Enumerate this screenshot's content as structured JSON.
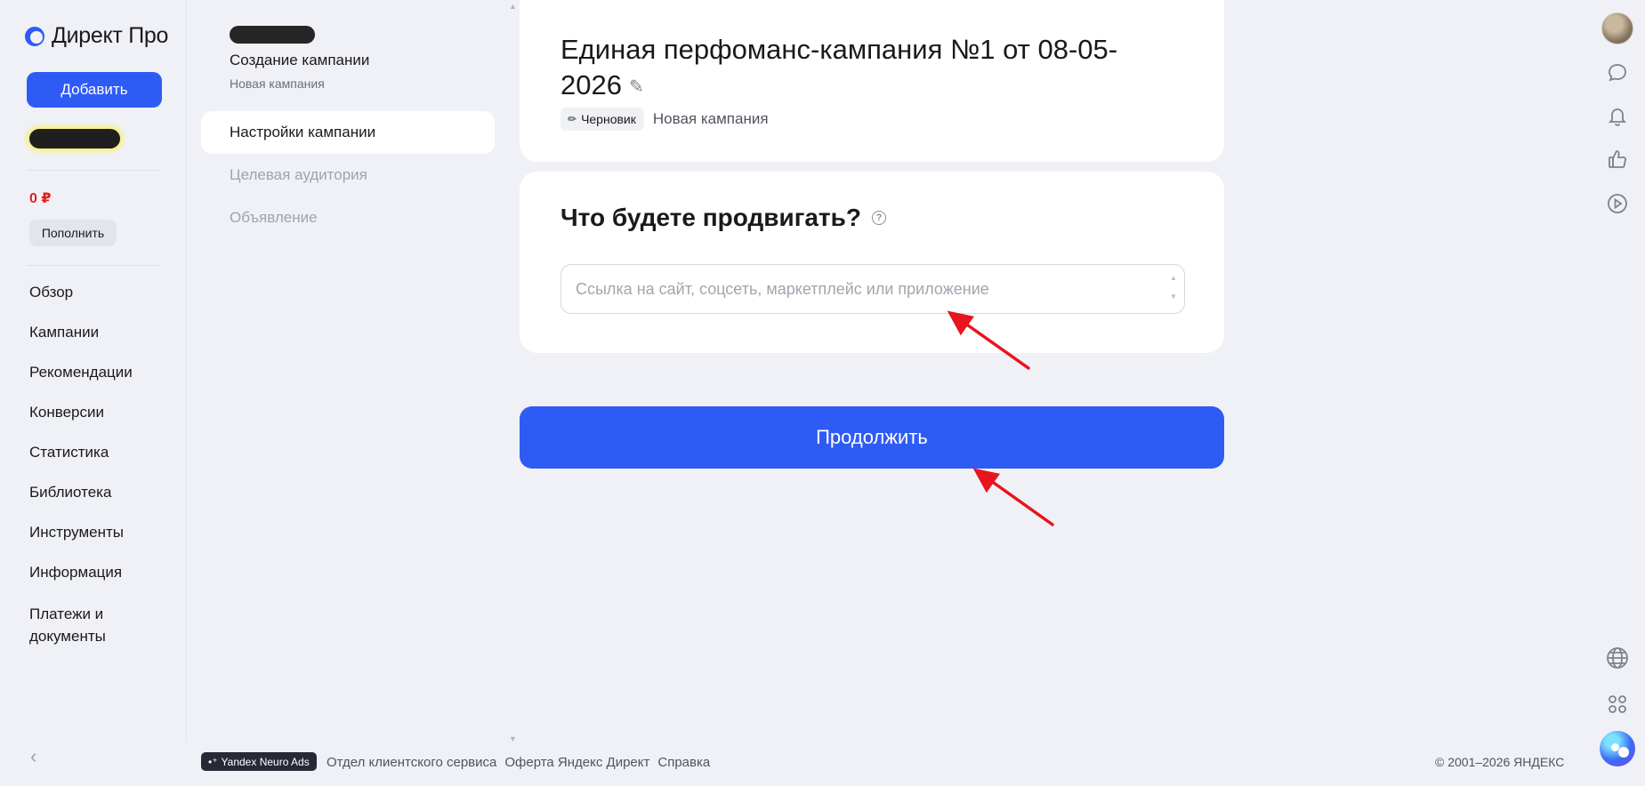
{
  "app": {
    "logo_text": "Директ Про"
  },
  "sidebar": {
    "add_button": "Добавить",
    "balance": "0 ₽",
    "topup_button": "Пополнить",
    "nav": [
      "Обзор",
      "Кампании",
      "Рекомендации",
      "Конверсии",
      "Статистика",
      "Библиотека",
      "Инструменты",
      "Информация",
      "Платежи и документы"
    ],
    "collapse_glyph": "‹"
  },
  "wizard": {
    "title": "Создание кампании",
    "subtitle": "Новая кампания",
    "steps": [
      {
        "label": "Настройки кампании",
        "active": true
      },
      {
        "label": "Целевая аудитория",
        "active": false
      },
      {
        "label": "Объявление",
        "active": false
      }
    ]
  },
  "campaign": {
    "title": "Единая перфоманс-кампания №1 от 08-05-2026",
    "draft_badge": "Черновик",
    "status": "Новая кампания"
  },
  "promo": {
    "question": "Что будете продвигать?",
    "help_glyph": "?",
    "input_placeholder": "Ссылка на сайт, соцсеть, маркетплейс или приложение",
    "input_value": ""
  },
  "actions": {
    "continue_button": "Продолжить"
  },
  "footer": {
    "badge": "Yandex Neuro Ads",
    "links": [
      "Отдел клиентского сервиса",
      "Оферта Яндекс Директ",
      "Справка"
    ],
    "copyright": "© 2001–2026 ЯНДЕКС"
  },
  "colors": {
    "accent": "#2f5bf5",
    "background": "#f0f1f6",
    "card": "#ffffff",
    "balance": "#e61e1e",
    "annotation_arrow": "#e8141e"
  },
  "icons": {
    "right_rail": [
      "avatar",
      "chat-icon",
      "bell-icon",
      "thumbs-up-icon",
      "play-icon",
      "globe-icon",
      "apps-grid-icon",
      "alice-assistant-icon"
    ]
  }
}
